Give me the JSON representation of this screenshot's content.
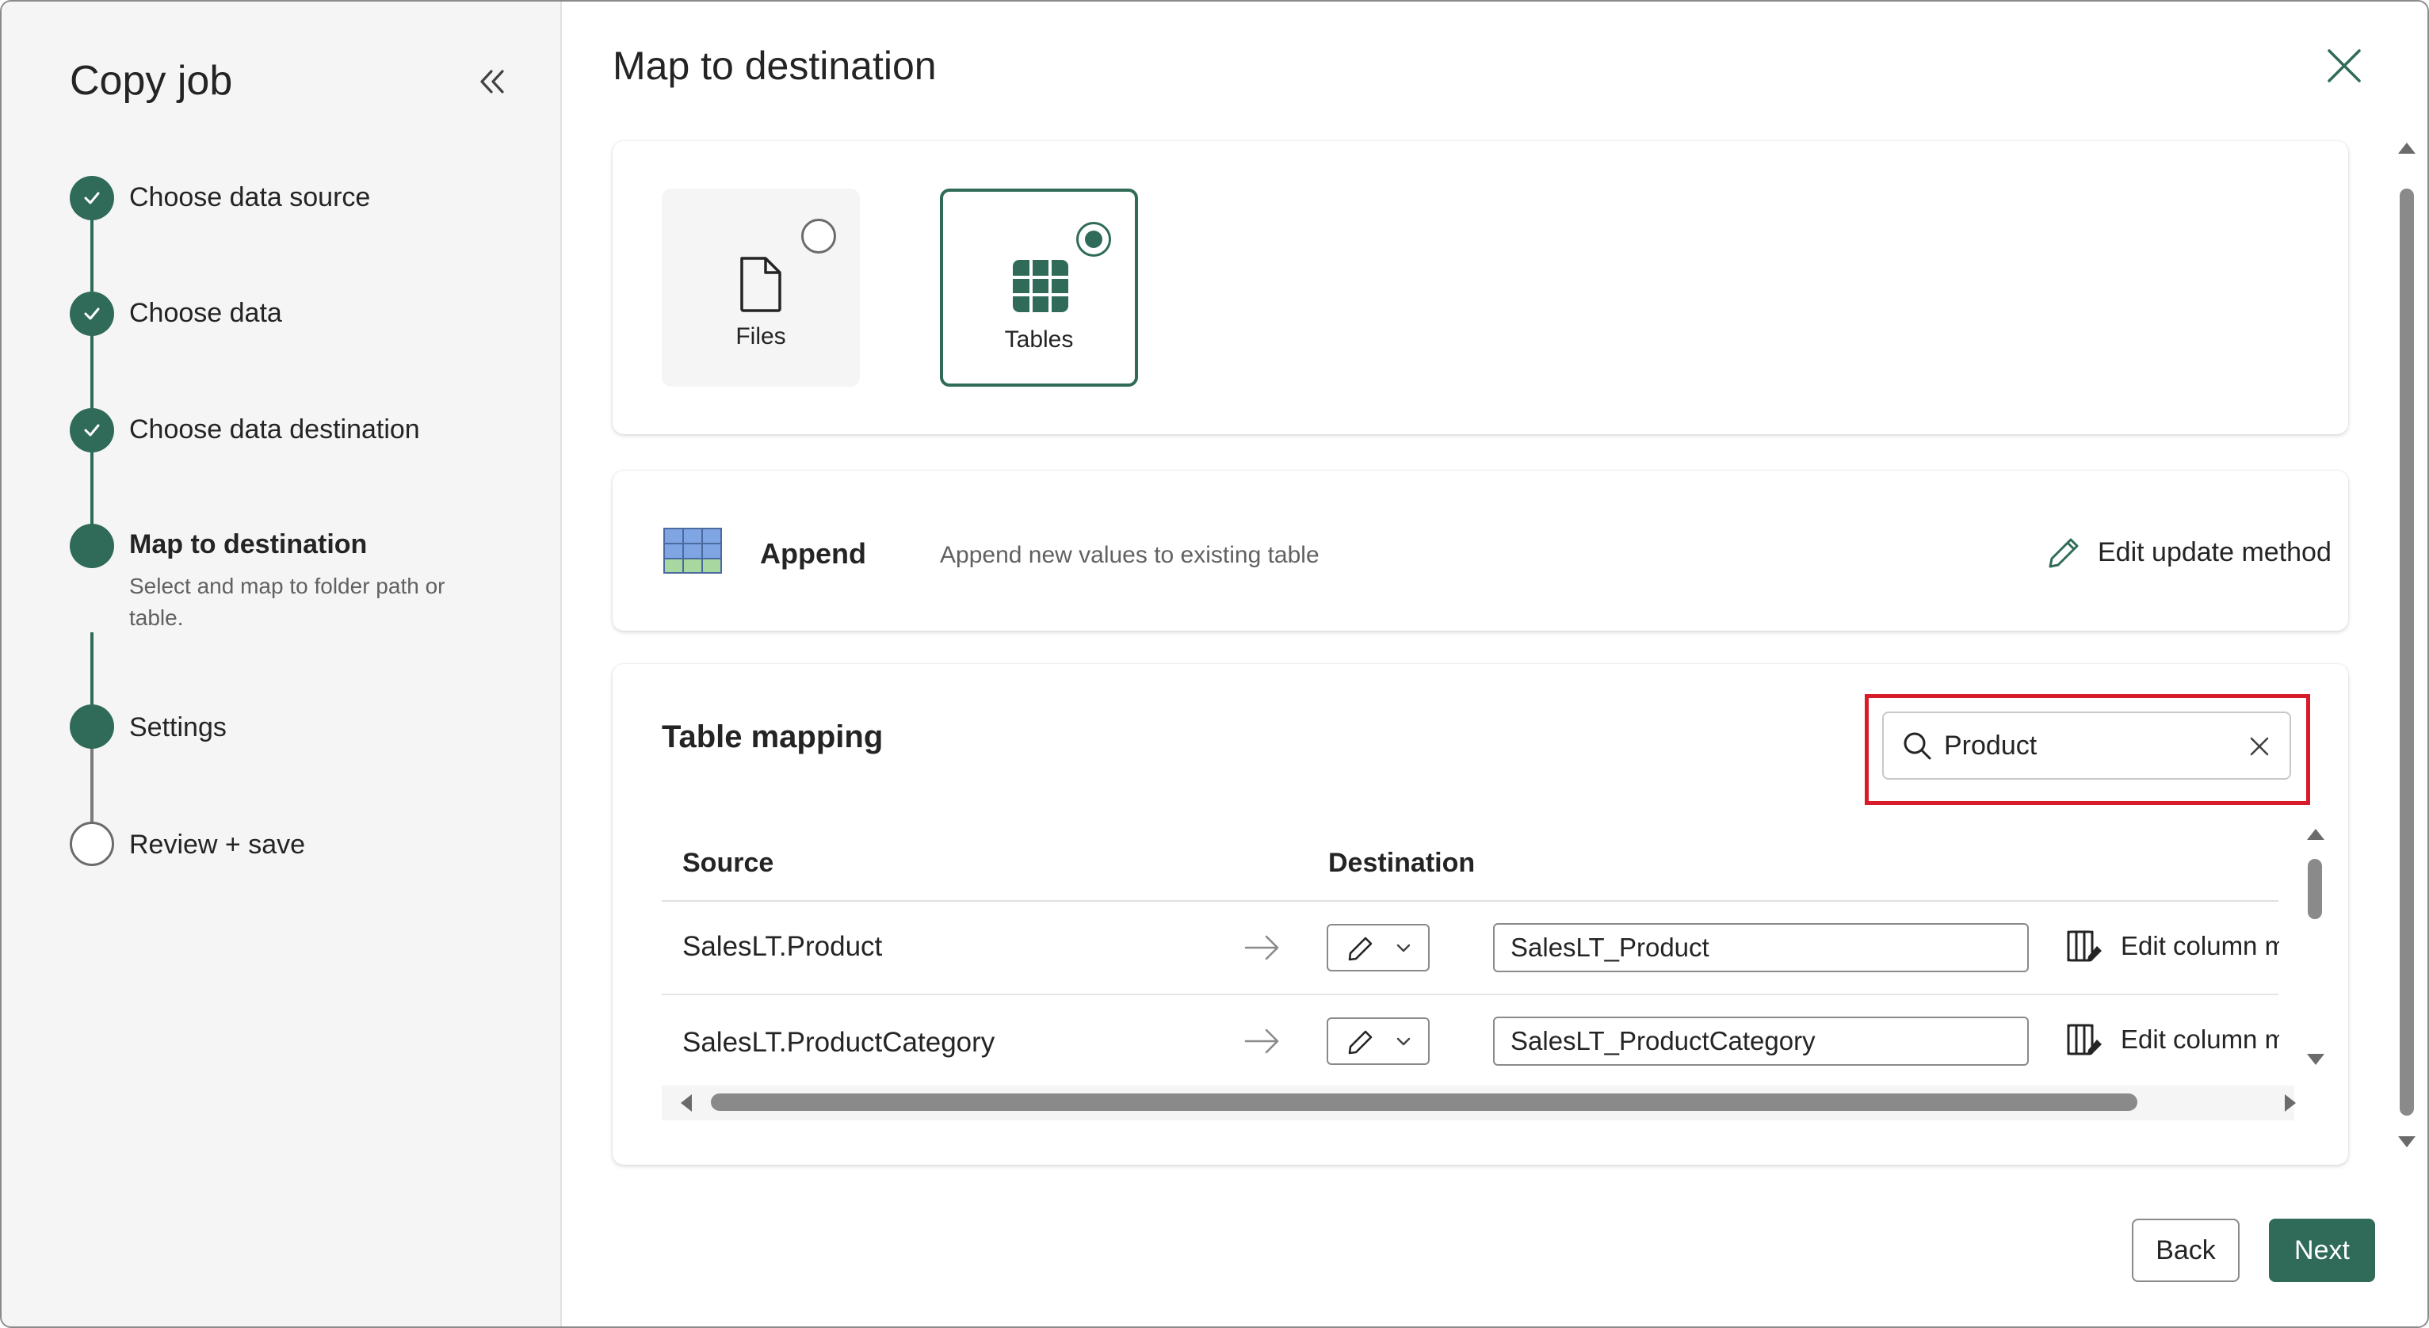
{
  "sidebar": {
    "title": "Copy job",
    "steps": [
      {
        "label": "Choose data source",
        "state": "completed"
      },
      {
        "label": "Choose data",
        "state": "completed"
      },
      {
        "label": "Choose data destination",
        "state": "completed"
      },
      {
        "label": "Map to destination",
        "state": "current",
        "description": "Select and map to folder path or table."
      },
      {
        "label": "Settings",
        "state": "upcoming"
      },
      {
        "label": "Review + save",
        "state": "upcoming"
      }
    ]
  },
  "main": {
    "title": "Map to destination",
    "destination_types": [
      {
        "label": "Files",
        "icon": "file-icon",
        "selected": false
      },
      {
        "label": "Tables",
        "icon": "table-grid-icon",
        "selected": true
      }
    ],
    "update_method": {
      "name": "Append",
      "description": "Append new values to existing table",
      "edit_label": "Edit update method",
      "icon": "append-table-icon"
    },
    "table_mapping": {
      "title": "Table mapping",
      "search_value": "Product",
      "columns": {
        "source": "Source",
        "destination": "Destination"
      },
      "rows": [
        {
          "source": "SalesLT.Product",
          "destination": "SalesLT_Product",
          "edit_label": "Edit column ma"
        },
        {
          "source": "SalesLT.ProductCategory",
          "destination": "SalesLT_ProductCategory",
          "edit_label": "Edit column ma"
        }
      ]
    }
  },
  "footer": {
    "back_label": "Back",
    "next_label": "Next"
  },
  "colors": {
    "accent": "#2f6b58",
    "highlight": "#d81b2b",
    "text": "#242424",
    "muted": "#616161"
  }
}
